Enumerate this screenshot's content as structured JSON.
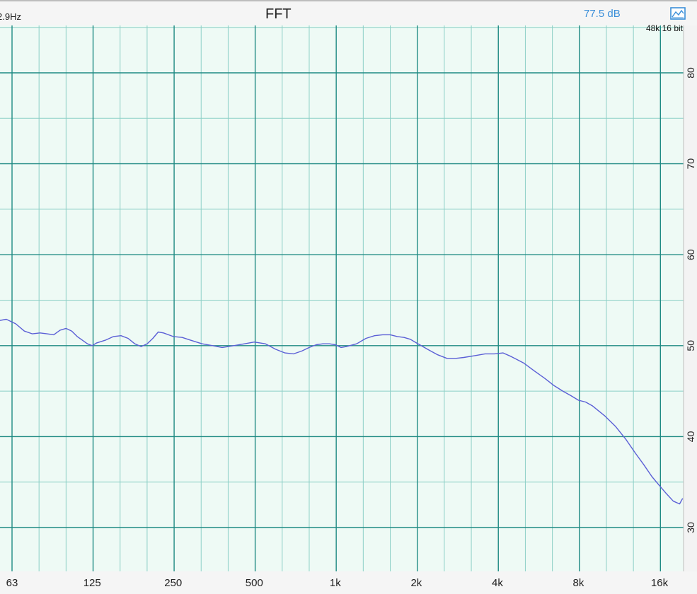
{
  "header": {
    "resolution": "2.9Hz",
    "title": "FFT",
    "level": "77.5 dB",
    "format": "48k 16 bit",
    "icon": "chart-icon"
  },
  "colors": {
    "plot_bg": "#eefaf5",
    "major_grid": "#1f8a83",
    "minor_grid": "#8ccfc6",
    "trace": "#5b5fd6",
    "accent": "#3b8fd9"
  },
  "chart_data": {
    "type": "line",
    "title": "FFT",
    "x_scale": "log",
    "xlim": [
      50,
      20000
    ],
    "ylim": [
      27,
      85
    ],
    "x_ticks": [
      {
        "value": 63,
        "label": "63"
      },
      {
        "value": 125,
        "label": "125"
      },
      {
        "value": 250,
        "label": "250"
      },
      {
        "value": 500,
        "label": "500"
      },
      {
        "value": 1000,
        "label": "1k"
      },
      {
        "value": 2000,
        "label": "2k"
      },
      {
        "value": 4000,
        "label": "4k"
      },
      {
        "value": 8000,
        "label": "8k"
      },
      {
        "value": 16000,
        "label": "16k"
      }
    ],
    "y_ticks": [
      {
        "value": 30,
        "label": "30"
      },
      {
        "value": 40,
        "label": "40"
      },
      {
        "value": 50,
        "label": "50"
      },
      {
        "value": 60,
        "label": "60"
      },
      {
        "value": 70,
        "label": "70"
      },
      {
        "value": 80,
        "label": "80"
      }
    ],
    "grid": true,
    "series": [
      {
        "points": [
          [
            50,
            52.5
          ],
          [
            55,
            52.7
          ],
          [
            60,
            52.9
          ],
          [
            65,
            52.4
          ],
          [
            70,
            51.6
          ],
          [
            75,
            51.3
          ],
          [
            80,
            51.4
          ],
          [
            85,
            51.3
          ],
          [
            90,
            51.2
          ],
          [
            95,
            51.7
          ],
          [
            100,
            51.9
          ],
          [
            105,
            51.6
          ],
          [
            110,
            51.0
          ],
          [
            115,
            50.6
          ],
          [
            120,
            50.2
          ],
          [
            125,
            50.0
          ],
          [
            130,
            50.3
          ],
          [
            140,
            50.6
          ],
          [
            150,
            51.0
          ],
          [
            160,
            51.1
          ],
          [
            170,
            50.8
          ],
          [
            180,
            50.2
          ],
          [
            190,
            49.9
          ],
          [
            200,
            50.2
          ],
          [
            210,
            50.8
          ],
          [
            220,
            51.5
          ],
          [
            230,
            51.4
          ],
          [
            250,
            51.0
          ],
          [
            270,
            50.9
          ],
          [
            290,
            50.6
          ],
          [
            320,
            50.2
          ],
          [
            350,
            50.0
          ],
          [
            380,
            49.8
          ],
          [
            420,
            50.0
          ],
          [
            460,
            50.2
          ],
          [
            500,
            50.4
          ],
          [
            550,
            50.2
          ],
          [
            600,
            49.6
          ],
          [
            650,
            49.2
          ],
          [
            700,
            49.1
          ],
          [
            750,
            49.4
          ],
          [
            800,
            49.8
          ],
          [
            850,
            50.1
          ],
          [
            900,
            50.2
          ],
          [
            950,
            50.2
          ],
          [
            1000,
            50.1
          ],
          [
            1050,
            49.8
          ],
          [
            1100,
            49.9
          ],
          [
            1200,
            50.2
          ],
          [
            1300,
            50.8
          ],
          [
            1400,
            51.1
          ],
          [
            1500,
            51.2
          ],
          [
            1600,
            51.2
          ],
          [
            1700,
            51.0
          ],
          [
            1800,
            50.9
          ],
          [
            1900,
            50.7
          ],
          [
            2000,
            50.3
          ],
          [
            2200,
            49.6
          ],
          [
            2400,
            49.0
          ],
          [
            2600,
            48.6
          ],
          [
            2800,
            48.6
          ],
          [
            3000,
            48.7
          ],
          [
            3300,
            48.9
          ],
          [
            3600,
            49.1
          ],
          [
            3900,
            49.1
          ],
          [
            4200,
            49.2
          ],
          [
            4500,
            48.8
          ],
          [
            5000,
            48.1
          ],
          [
            5500,
            47.2
          ],
          [
            6000,
            46.4
          ],
          [
            6500,
            45.6
          ],
          [
            7000,
            45.0
          ],
          [
            7500,
            44.5
          ],
          [
            8000,
            44.0
          ],
          [
            8500,
            43.8
          ],
          [
            9000,
            43.4
          ],
          [
            10000,
            42.3
          ],
          [
            11000,
            41.1
          ],
          [
            12000,
            39.7
          ],
          [
            13000,
            38.2
          ],
          [
            14000,
            36.9
          ],
          [
            15000,
            35.6
          ],
          [
            16000,
            34.6
          ],
          [
            17000,
            33.7
          ],
          [
            18000,
            32.9
          ],
          [
            19000,
            32.6
          ],
          [
            19500,
            33.2
          ]
        ]
      }
    ]
  }
}
